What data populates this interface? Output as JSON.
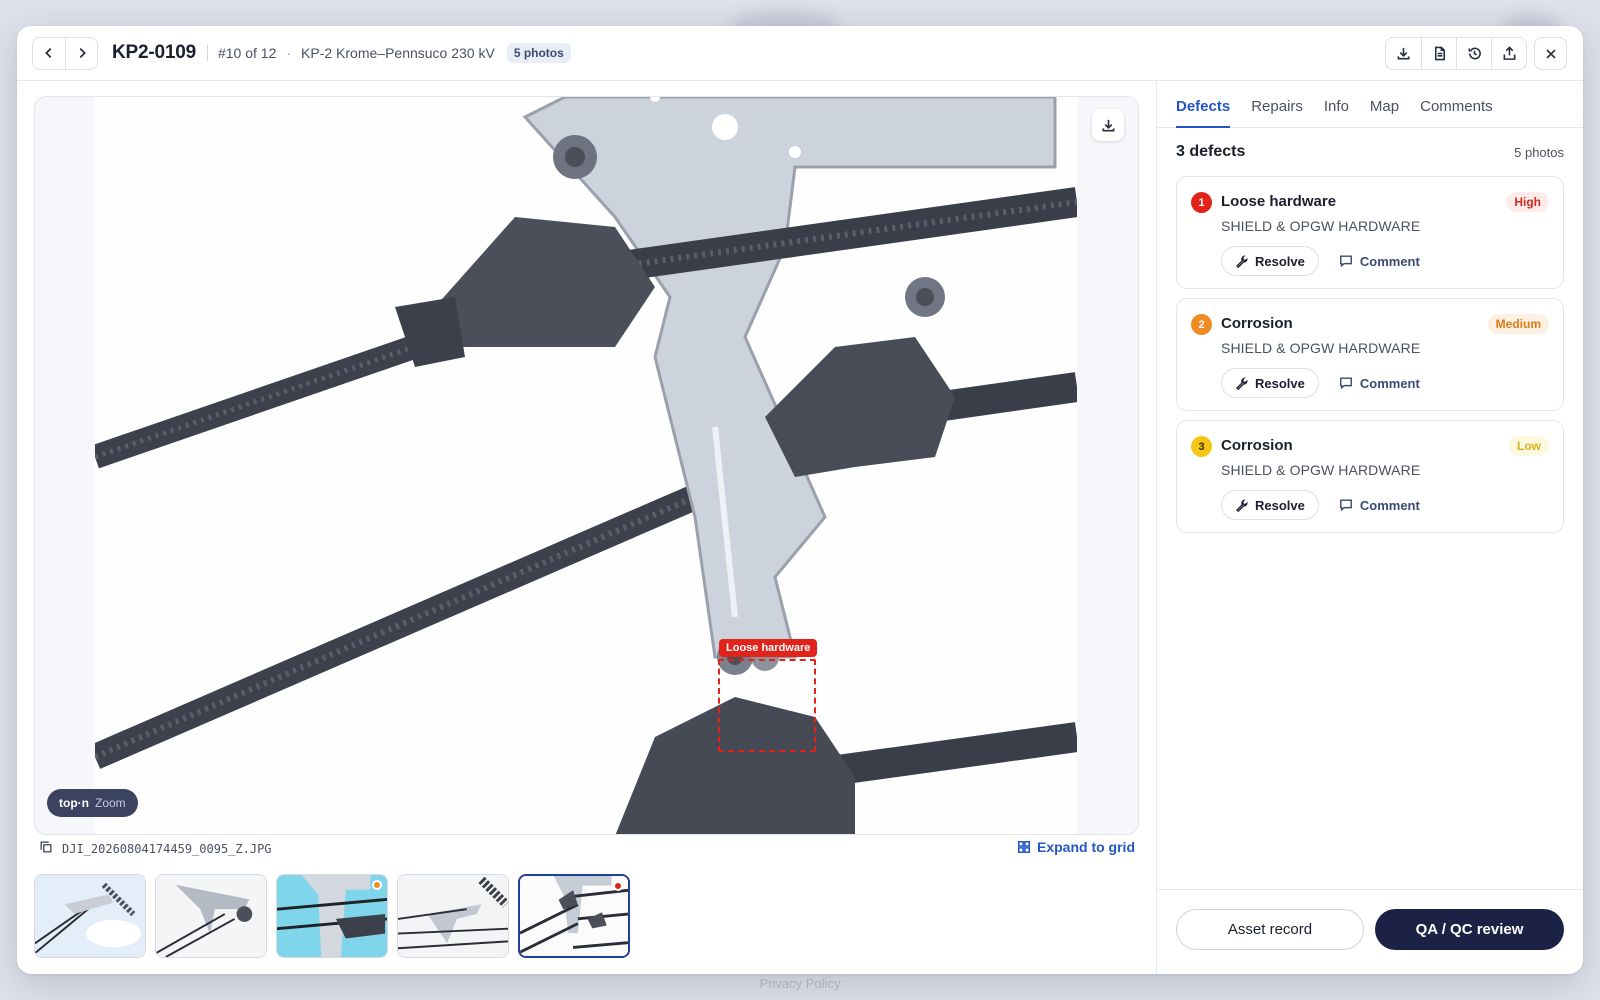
{
  "header": {
    "asset_id": "KP2-0109",
    "position": "#10 of 12",
    "line_name": "KP-2 Krome–Pennsuco 230 kV",
    "photo_pill": "5 photos",
    "actions": [
      "download-icon",
      "document-icon",
      "history-icon",
      "share-icon"
    ],
    "close_icon": "close-icon"
  },
  "viewer": {
    "annotation_label": "Loose hardware",
    "zoom_key": "top·n",
    "zoom_label": "Zoom",
    "filename": "DJI_20260804174459_0095_Z.JPG",
    "expand_label": "Expand to grid"
  },
  "thumbnails": [
    {
      "index": 1,
      "active": false,
      "dot": null
    },
    {
      "index": 2,
      "active": false,
      "dot": null
    },
    {
      "index": 3,
      "active": false,
      "dot": "#f08a24"
    },
    {
      "index": 4,
      "active": false,
      "dot": null
    },
    {
      "index": 5,
      "active": true,
      "dot": "#e2231a"
    }
  ],
  "panel": {
    "tabs": [
      {
        "label": "Defects",
        "active": true
      },
      {
        "label": "Repairs",
        "active": false
      },
      {
        "label": "Info",
        "active": false
      },
      {
        "label": "Map",
        "active": false
      },
      {
        "label": "Comments",
        "active": false
      }
    ],
    "defects_count": "3 defects",
    "photos_count": "5 photos",
    "defects": [
      {
        "num": "1",
        "title": "Loose hardware",
        "subtitle": "SHIELD & OPGW HARDWARE",
        "severity": "High",
        "color": "#e2231a",
        "sev_bg": "#fdecea",
        "sev_fg": "#d12a20",
        "resolve": "Resolve",
        "comment": "Comment"
      },
      {
        "num": "2",
        "title": "Corrosion",
        "subtitle": "SHIELD & OPGW HARDWARE",
        "severity": "Medium",
        "color": "#f08a24",
        "sev_bg": "#fdf0e2",
        "sev_fg": "#dc7a16",
        "resolve": "Resolve",
        "comment": "Comment"
      },
      {
        "num": "3",
        "title": "Corrosion",
        "subtitle": "SHIELD & OPGW HARDWARE",
        "severity": "Low",
        "color": "#f5c518",
        "sev_bg": "#fdf8e0",
        "sev_fg": "#d8b21a",
        "resolve": "Resolve",
        "comment": "Comment"
      }
    ],
    "footer": {
      "secondary": "Asset record",
      "primary": "QA / QC review"
    }
  },
  "page_footer": "Privacy Policy"
}
